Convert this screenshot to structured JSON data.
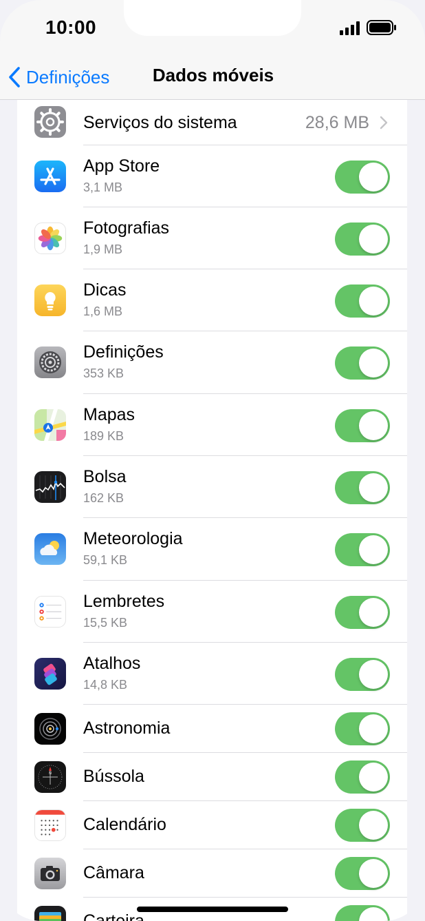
{
  "status_bar": {
    "time": "10:00"
  },
  "nav": {
    "back_label": "Definições",
    "title": "Dados móveis"
  },
  "system_services": {
    "label": "Serviços do sistema",
    "value": "28,6 MB"
  },
  "apps": [
    {
      "name": "App Store",
      "usage": "3,1 MB",
      "icon": "app-store-icon",
      "enabled": true
    },
    {
      "name": "Fotografias",
      "usage": "1,9 MB",
      "icon": "photos-icon",
      "enabled": true
    },
    {
      "name": "Dicas",
      "usage": "1,6 MB",
      "icon": "tips-icon",
      "enabled": true
    },
    {
      "name": "Definições",
      "usage": "353 KB",
      "icon": "settings-icon",
      "enabled": true
    },
    {
      "name": "Mapas",
      "usage": "189 KB",
      "icon": "maps-icon",
      "enabled": true
    },
    {
      "name": "Bolsa",
      "usage": "162 KB",
      "icon": "stocks-icon",
      "enabled": true
    },
    {
      "name": "Meteorologia",
      "usage": "59,1 KB",
      "icon": "weather-icon",
      "enabled": true
    },
    {
      "name": "Lembretes",
      "usage": "15,5 KB",
      "icon": "reminders-icon",
      "enabled": true
    },
    {
      "name": "Atalhos",
      "usage": "14,8 KB",
      "icon": "shortcuts-icon",
      "enabled": true
    },
    {
      "name": "Astronomia",
      "icon": "astronomy-icon",
      "enabled": true
    },
    {
      "name": "Bússola",
      "icon": "compass-icon",
      "enabled": true
    },
    {
      "name": "Calendário",
      "icon": "calendar-icon",
      "enabled": true
    },
    {
      "name": "Câmara",
      "icon": "camera-icon",
      "enabled": true
    },
    {
      "name": "Carteira",
      "icon": "wallet-icon",
      "enabled": true
    }
  ],
  "colors": {
    "accent": "#0a7aff",
    "toggle_on": "#64c466"
  }
}
